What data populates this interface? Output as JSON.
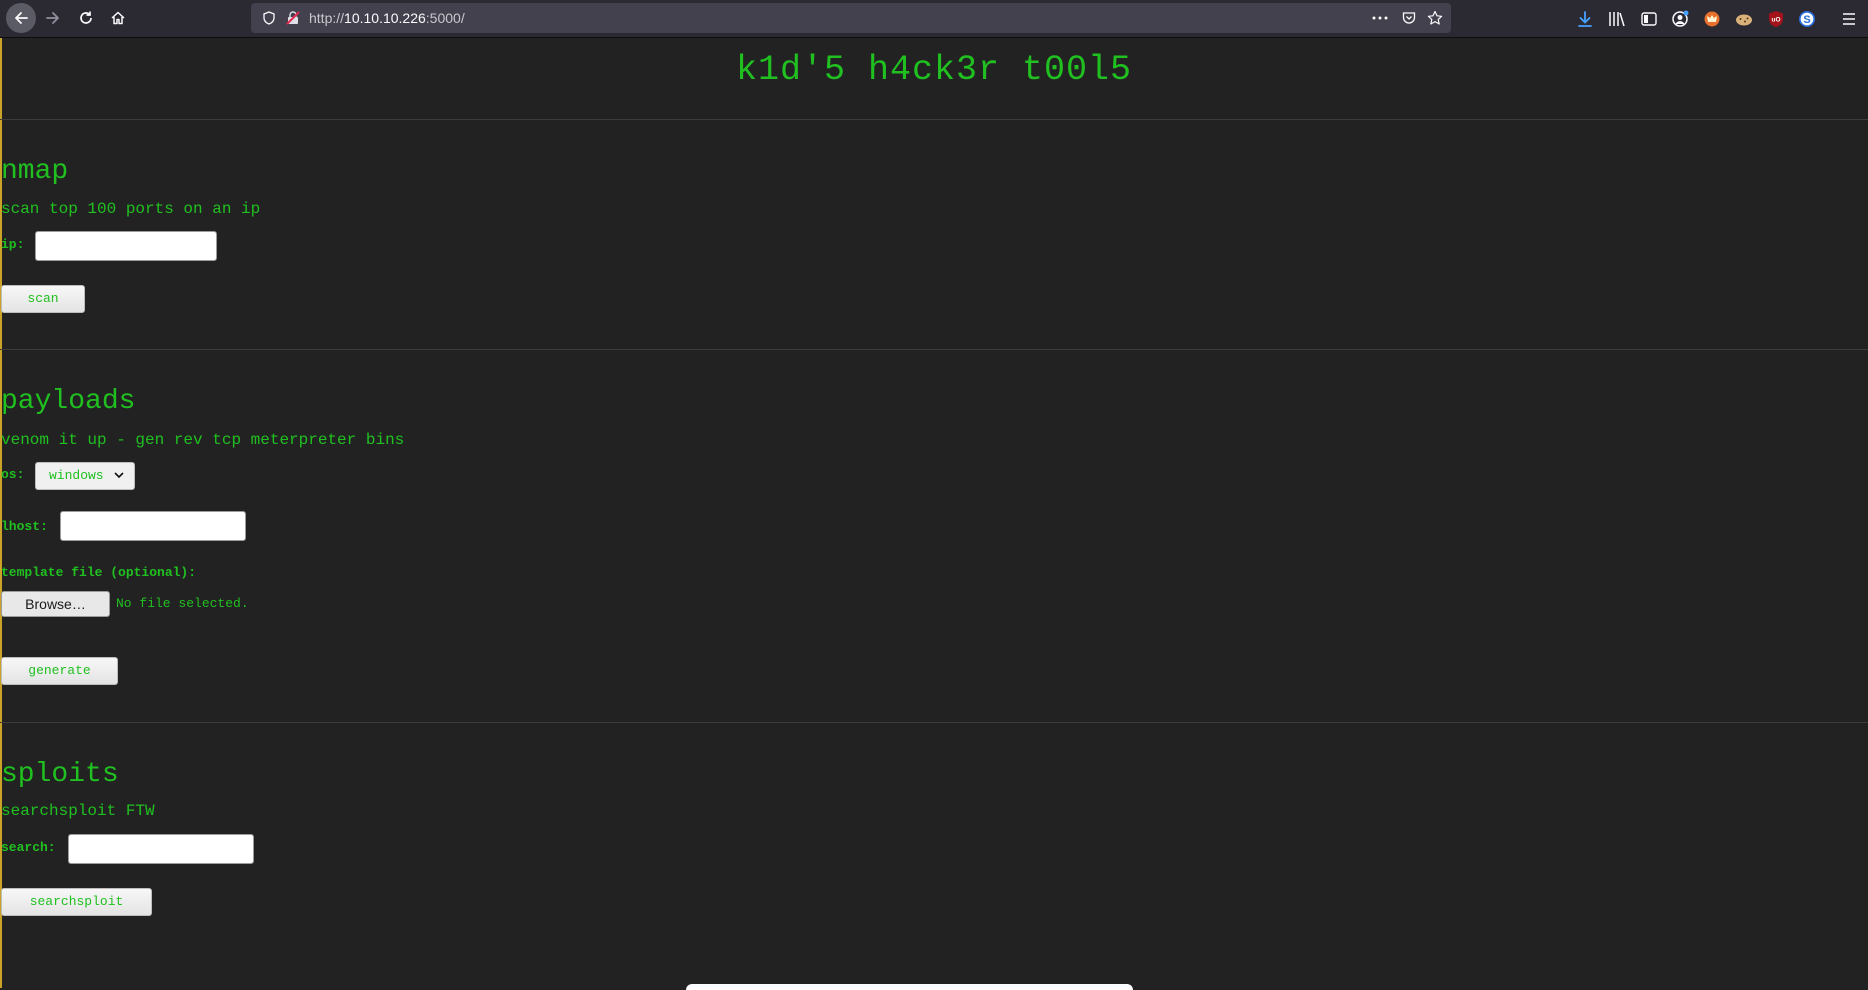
{
  "browser": {
    "url_prefix": "http://",
    "url_host": "10.10.10.226",
    "url_suffix": ":5000/"
  },
  "page": {
    "title": "k1d'5 h4ck3r t00l5"
  },
  "nmap": {
    "heading": "nmap",
    "description": "scan top 100 ports on an ip",
    "ip_label": "ip:",
    "ip_value": "",
    "button": "scan"
  },
  "payloads": {
    "heading": "payloads",
    "description": "venom it up - gen rev tcp meterpreter bins",
    "os_label": "os:",
    "os_selected": "windows",
    "lhost_label": "lhost:",
    "lhost_value": "",
    "template_label": "template file (optional):",
    "browse_button": "Browse…",
    "file_status": "No file selected.",
    "button": "generate"
  },
  "sploits": {
    "heading": "sploits",
    "description": "searchsploit FTW",
    "search_label": "search:",
    "search_value": "",
    "button": "searchsploit"
  },
  "colors": {
    "background": "#222222",
    "accent_green": "#20c020"
  }
}
